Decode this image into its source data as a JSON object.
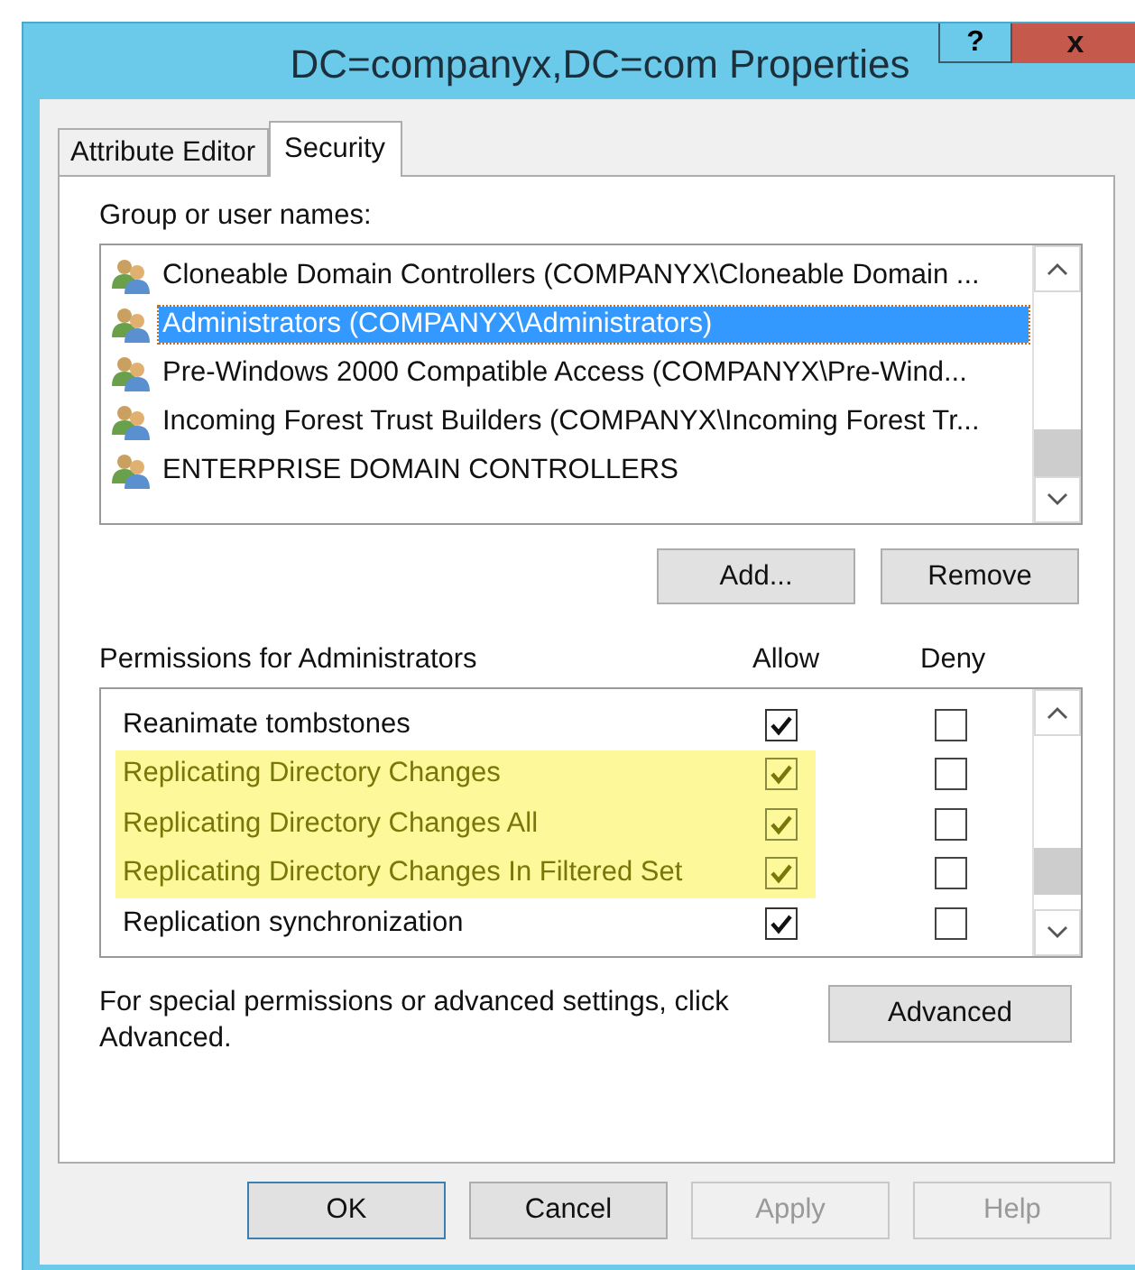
{
  "window": {
    "title": "DC=companyx,DC=com Properties",
    "help_button": "?",
    "close_button": "x"
  },
  "tabs": [
    {
      "label": "Attribute Editor",
      "selected": false
    },
    {
      "label": "Security",
      "selected": true
    }
  ],
  "group_label": "Group or user names:",
  "groups": [
    {
      "name": "Cloneable Domain Controllers (COMPANYX\\Cloneable Domain ...",
      "selected": false
    },
    {
      "name": "Administrators (COMPANYX\\Administrators)",
      "selected": true
    },
    {
      "name": "Pre-Windows 2000 Compatible Access (COMPANYX\\Pre-Wind...",
      "selected": false
    },
    {
      "name": "Incoming Forest Trust Builders (COMPANYX\\Incoming Forest Tr...",
      "selected": false
    },
    {
      "name": "ENTERPRISE DOMAIN CONTROLLERS",
      "selected": false
    }
  ],
  "group_buttons": [
    "Add...",
    "Remove"
  ],
  "permissions_label": "Permissions for Administrators",
  "permission_columns": [
    "Allow",
    "Deny"
  ],
  "permissions": [
    {
      "name": "Reanimate tombstones",
      "allow": true,
      "deny": false,
      "highlighted": false
    },
    {
      "name": "Replicating Directory Changes",
      "allow": true,
      "deny": false,
      "highlighted": true
    },
    {
      "name": "Replicating Directory Changes All",
      "allow": true,
      "deny": false,
      "highlighted": true
    },
    {
      "name": "Replicating Directory Changes In Filtered Set",
      "allow": true,
      "deny": false,
      "highlighted": true
    },
    {
      "name": "Replication synchronization",
      "allow": true,
      "deny": false,
      "highlighted": false
    }
  ],
  "advanced_note": "For special permissions or advanced settings, click Advanced.",
  "advanced_button": "Advanced",
  "dialog_buttons": [
    {
      "label": "OK",
      "disabled": false
    },
    {
      "label": "Cancel",
      "disabled": false
    },
    {
      "label": "Apply",
      "disabled": true
    },
    {
      "label": "Help",
      "disabled": true
    }
  ]
}
